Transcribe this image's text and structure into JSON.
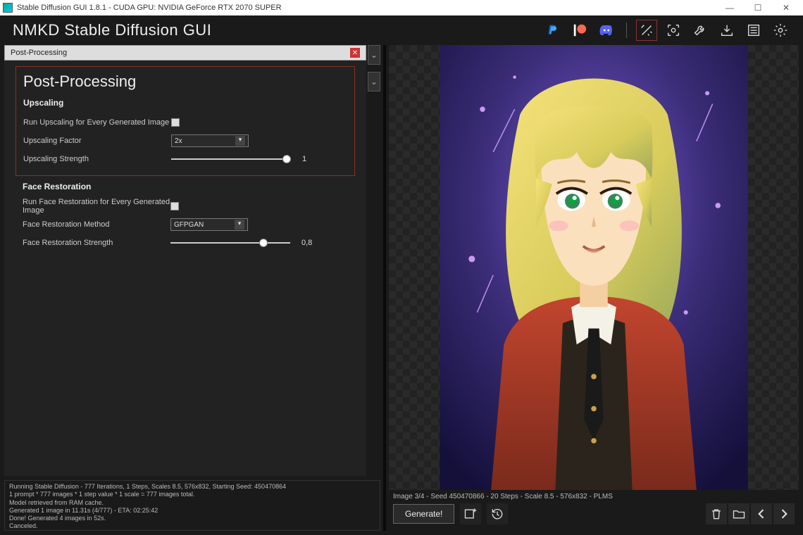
{
  "window": {
    "title": "Stable Diffusion GUI 1.8.1 - CUDA GPU: NVIDIA GeForce RTX 2070 SUPER"
  },
  "header": {
    "app_title": "NMKD Stable Diffusion GUI"
  },
  "panel": {
    "tab_label": "Post-Processing",
    "section_title": "Post-Processing",
    "upscaling": {
      "heading": "Upscaling",
      "run_label": "Run Upscaling for Every Generated Image",
      "factor_label": "Upscaling Factor",
      "factor_value": "2x",
      "strength_label": "Upscaling Strength",
      "strength_value": "1",
      "strength_pos": 1.0
    },
    "face": {
      "heading": "Face Restoration",
      "run_label": "Run Face Restoration for Every Generated Image",
      "method_label": "Face Restoration Method",
      "method_value": "GFPGAN",
      "strength_label": "Face Restoration Strength",
      "strength_value": "0,8",
      "strength_pos": 0.8
    }
  },
  "log": {
    "l1": "Running Stable Diffusion - 777 Iterations, 1 Steps, Scales 8.5, 576x832, Starting Seed: 450470864",
    "l2": "1 prompt * 777 images * 1 step value * 1 scale = 777 images total.",
    "l3": "Model retrieved from RAM cache.",
    "l4": "Generated 1 image in 11.31s (4/777) - ETA: 02:25:42",
    "l5": "Done! Generated 4 images in 52s.",
    "l6": "Canceled."
  },
  "preview": {
    "info": "Image 3/4 - Seed 450470866 - 20 Steps - Scale 8.5 - 576x832 - PLMS",
    "generate_label": "Generate!"
  }
}
